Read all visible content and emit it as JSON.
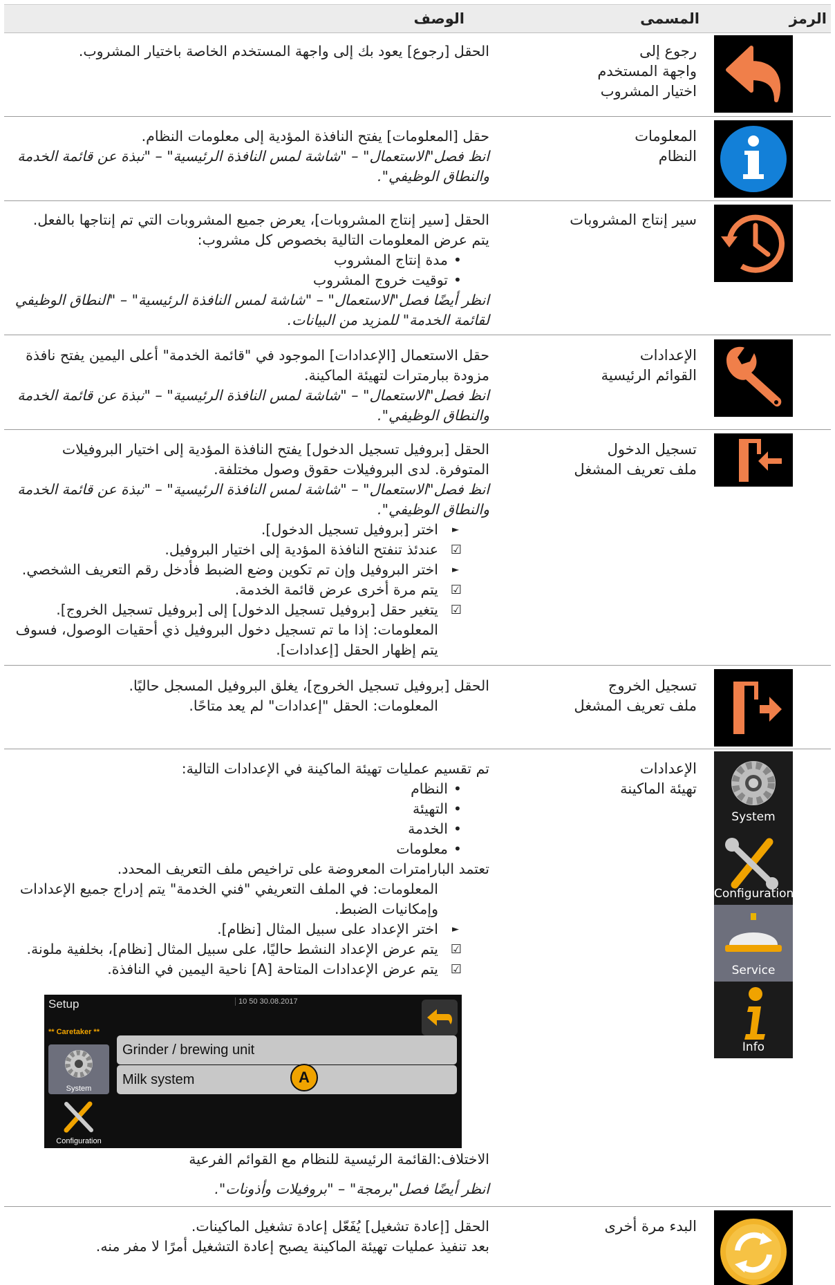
{
  "header": {
    "symbol": "الرمز",
    "name": "المسمى",
    "description": "الوصف"
  },
  "rows": [
    {
      "name": "رجوع إلى\nواجهة المستخدم\nاختيار المشروب",
      "icon": "back-arrow-icon",
      "desc": [
        "الحقل [رجوع] يعود بك إلى واجهة المستخدم الخاصة باختيار المشروب."
      ]
    },
    {
      "name": "المعلومات\nالنظام",
      "icon": "info-icon",
      "desc": [
        "حقل [المعلومات] يفتح النافذة المؤدية إلى معلومات النظام."
      ],
      "ref": "انظ فصل\"الاستعمال\" – \"شاشة لمس النافذة الرئيسية\" – \"نبذة عن قائمة الخدمة والنطاق الوظيفي\"."
    },
    {
      "name": "سير إنتاج المشروبات",
      "icon": "history-clock-icon",
      "desc": [
        "الحقل [سير إنتاج المشروبات]، يعرض جميع المشروبات التي تم إنتاجها بالفعل.",
        "يتم عرض المعلومات التالية بخصوص كل مشروب:"
      ],
      "bullets": [
        "مدة إنتاج المشروب",
        "توقيت خروج المشروب"
      ],
      "ref": "انظر أيضًا فصل\"الاستعمال\" – \"شاشة لمس النافذة الرئيسية\" – \"النطاق الوظيفي لقائمة الخدمة\" للمزيد من البيانات."
    },
    {
      "name": "الإعدادات\nالقوائم الرئيسية",
      "icon": "wrench-icon",
      "desc": [
        "حقل الاستعمال [الإعدادات] الموجود في \"قائمة الخدمة\" أعلى اليمين يفتح نافذة مزودة ببارمترات لتهيئة الماكينة."
      ],
      "ref": "انظ فصل\"الاستعمال\" – \"شاشة لمس النافذة الرئيسية\" – \"نبذة عن قائمة الخدمة والنطاق الوظيفي\"."
    },
    {
      "name": "تسجيل الدخول\nملف تعريف المشغل",
      "icon": "login-icon",
      "desc": [
        "الحقل [بروفيل تسجيل الدخول] يفتح النافذة المؤدية إلى اختيار البروفيلات المتوفرة. لدى البروفيلات حقوق وصول مختلفة."
      ],
      "ref": "انظ فصل\"الاستعمال\" – \"شاشة لمس النافذة الرئيسية\" – \"نبذة عن قائمة الخدمة والنطاق الوظيفي\".",
      "steps": [
        {
          "t": "act",
          "s": "اختر [بروفيل تسجيل الدخول]."
        },
        {
          "t": "res",
          "s": "عندئذ تنفتح النافذة المؤدية إلى اختيار البروفيل."
        },
        {
          "t": "act",
          "s": "اختر البروفيل وإن تم تكوين وضع الضبط فأدخل رقم التعريف الشخصي."
        },
        {
          "t": "res",
          "s": "يتم مرة أخرى عرض قائمة الخدمة."
        },
        {
          "t": "res",
          "s": "يتغير حقل [بروفيل تسجيل الدخول] إلى [بروفيل تسجيل الخروج]."
        },
        {
          "t": "ind",
          "s": "المعلومات: إذا ما تم تسجيل دخول البروفيل ذي أحقيات الوصول، فسوف يتم إظهار الحقل [إعدادات]."
        }
      ]
    },
    {
      "name": "تسجيل الخروج\nملف تعريف المشغل",
      "icon": "logout-icon",
      "desc": [
        "الحقل [بروفيل تسجيل الخروج]، يغلق البروفيل المسجل حاليًا."
      ],
      "steps": [
        {
          "t": "ind",
          "s": "المعلومات: الحقل \"إعدادات\" لم يعد متاحًا."
        }
      ]
    },
    {
      "name": "الإعدادات\nتهيئة الماكينة",
      "icon": "setup-tiles",
      "desc": [
        "تم تقسيم عمليات تهيئة الماكينة في الإعدادات التالية:"
      ],
      "bullets": [
        "النظام",
        "التهيئة",
        "الخدمة",
        "معلومات"
      ],
      "desc2": "تعتمد البارامترات المعروضة على تراخيص ملف التعريف المحدد.",
      "steps": [
        {
          "t": "ind",
          "s": "المعلومات: في الملف التعريفي \"فني الخدمة\" يتم إدراج جميع الإعدادات وإمكانيات الضبط."
        },
        {
          "t": "act",
          "s": "اختر الإعداد على سبيل المثال [نظام]."
        },
        {
          "t": "res",
          "s": "يتم عرض الإعداد النشط حاليًا، على سبيل المثال [نظام]، بخلفية ملونة."
        },
        {
          "t": "res",
          "s": "يتم عرض الإعدادات المتاحة [A] ناحية اليمين في النافذة."
        }
      ],
      "tiles": [
        "System",
        "Configuration",
        "Service",
        "Info"
      ],
      "screenshot": {
        "title": "Setup",
        "time": "10 50 30.08.2017",
        "caretaker": "** Caretaker **",
        "menu": [
          "Grinder / brewing unit",
          "Milk system"
        ],
        "callout": "A",
        "side": [
          "System",
          "Configuration"
        ]
      },
      "caption": "الاختلاف:القائمة الرئيسية للنظام مع القوائم الفرعية",
      "see": "انظر أيضًا فصل\"برمجة\" – \"بروفيلات وأذونات\"."
    },
    {
      "name": "البدء مرة أخرى",
      "icon": "restart-icon",
      "desc": [
        "الحقل [إعادة تشغيل] يُفَعّل إعادة تشغيل الماكينات.",
        "بعد تنفيذ عمليات تهيئة الماكينة يصبح إعادة التشغيل أمرًا لا مفر منه."
      ]
    }
  ]
}
